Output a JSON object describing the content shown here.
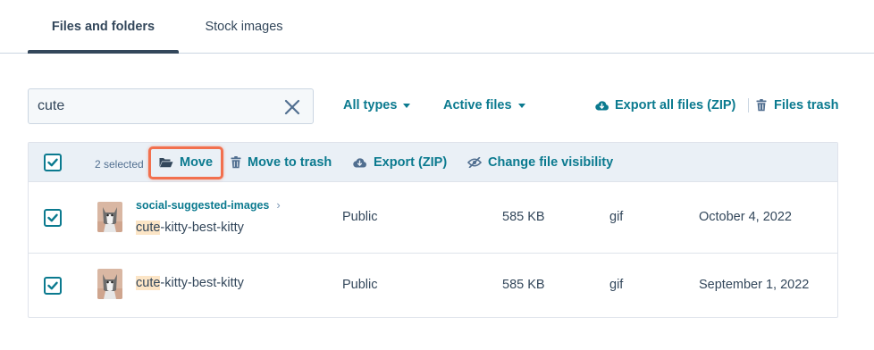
{
  "tabs": [
    {
      "label": "Files and folders",
      "active": true
    },
    {
      "label": "Stock images",
      "active": false
    }
  ],
  "search": {
    "value": "cute",
    "placeholder": ""
  },
  "filters": {
    "type_label": "All types",
    "status_label": "Active files",
    "export_all_label": "Export all files (ZIP)",
    "trash_label": "Files trash"
  },
  "bulk_actions": {
    "selected_count": "2 selected",
    "move_label": "Move",
    "move_to_trash_label": "Move to trash",
    "export_zip_label": "Export (ZIP)",
    "visibility_label": "Change file visibility"
  },
  "files": [
    {
      "folder": "social-suggested-images",
      "name_match": "cute",
      "name_rest": "-kitty-best-kitty",
      "visibility": "Public",
      "size": "585 KB",
      "type": "gif",
      "date": "October 4, 2022",
      "checked": true
    },
    {
      "folder": "",
      "name_match": "cute",
      "name_rest": "-kitty-best-kitty",
      "visibility": "Public",
      "size": "585 KB",
      "type": "gif",
      "date": "September 1, 2022",
      "checked": true
    }
  ],
  "colors": {
    "accent": "#0b7a8f",
    "text": "#33475b",
    "header_bg": "#eaf0f6",
    "highlight_box": "#f2704e",
    "match_highlight": "#fce5c6"
  },
  "icons": {
    "clear": "close-icon",
    "export_all": "cloud-download-icon",
    "trash": "trash-icon",
    "move": "folder-open-icon",
    "export_zip": "cloud-download-icon",
    "visibility": "eye-slash-icon",
    "folder_chevron": "chevron-right-icon"
  }
}
